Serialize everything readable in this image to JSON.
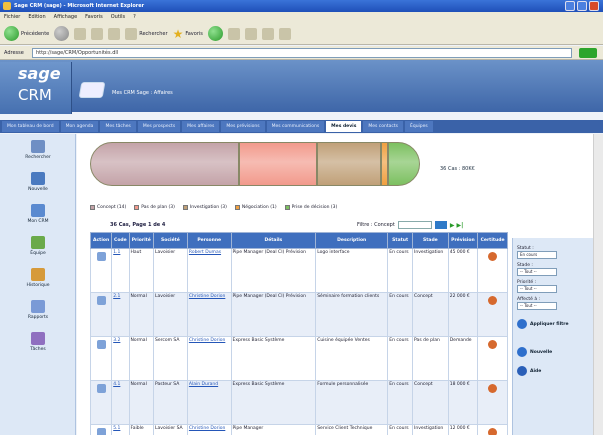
{
  "window": {
    "title": "Sage CRM (sage) - Microsoft Internet Explorer"
  },
  "menu": [
    "Fichier",
    "Edition",
    "Affichage",
    "Favoris",
    "Outils",
    "?"
  ],
  "toolbar": {
    "back": "Précédente",
    "search": "Rechercher",
    "favorites": "Favoris"
  },
  "address": {
    "label": "Adresse",
    "value": "http://sage/CRM/Opportunités.dll"
  },
  "header": {
    "brand_top": "sage",
    "brand_bottom": "CRM",
    "subtitle": "Mes CRM Sage : Affaires"
  },
  "tabs": [
    "Mon tableau de bord",
    "Mon agenda",
    "Mes tâches",
    "Mes prospects",
    "Mes affaires",
    "Mes prévisions",
    "Mes communications",
    "Mes devis",
    "Mes contacts",
    "Équipes"
  ],
  "active_tab_index": 7,
  "sidebar": [
    {
      "label": "Rechercher",
      "color": "#6f8fc4"
    },
    {
      "label": "Nouvelle",
      "color": "#4a7ac0"
    },
    {
      "label": "Mon CRM",
      "color": "#5a8ad0"
    },
    {
      "label": "Équipe",
      "color": "#6aaa4a"
    },
    {
      "label": "Historique",
      "color": "#d69a3a"
    },
    {
      "label": "Rapports",
      "color": "#7a9ad6"
    },
    {
      "label": "Tâches",
      "color": "#8f6fc0"
    }
  ],
  "pipeline": {
    "stages": [
      {
        "name": "Concept",
        "value": 42,
        "color": "#c4a3a8"
      },
      {
        "name": "Pas de plan",
        "value": 22,
        "color": "#f29a8c"
      },
      {
        "name": "Investigation",
        "value": 18,
        "color": "#c0a078"
      },
      {
        "name": "Négociation",
        "value": 2,
        "color": "#f0a040"
      },
      {
        "name": "Prise de décision",
        "value": 9,
        "color": "#7cc060"
      }
    ],
    "summary": "36 Cas : 80K€"
  },
  "legend": [
    "Concept (14)",
    "Pas de plan (3)",
    "Investigation (3)",
    "Négociation (1)",
    "Prise de décision (3)"
  ],
  "grid": {
    "pager": "36 Cas, Page 1 de 4",
    "filter_label": "Filtre : Concept",
    "headers": [
      "Action",
      "Code",
      "Priorité",
      "Société",
      "Personne",
      "Détails",
      "Description",
      "Statut",
      "Stade",
      "Prévision",
      "Certitude"
    ],
    "rows": [
      [
        "",
        "1.1",
        "Haut",
        "Lavoisier",
        "Robert Dumas",
        "Pipe Manager (Deal CI) Prévision",
        "Logo interface",
        "En cours",
        "Investigation",
        "45 000 €",
        ""
      ],
      [
        "",
        "2.1",
        "Normal",
        "Lavoisier",
        "Christine Dorion",
        "Pipe Manager (Deal CI) Prévision",
        "Séminaire formation clients",
        "En cours",
        "Concept",
        "22 000 €",
        ""
      ],
      [
        "",
        "3.2",
        "Normal",
        "Sercom SA",
        "Christine Dorion",
        "Express Basic Système",
        "Cuisine équipée Ventes",
        "En cours",
        "Pas de plan",
        "Demande",
        ""
      ],
      [
        "",
        "4.1",
        "Normal",
        "Pasteur SA",
        "Alain Durand",
        "Express Basic Système",
        "Formule personnalisée",
        "En cours",
        "Concept",
        "18 000 €",
        ""
      ],
      [
        "",
        "5.1",
        "Faible",
        "Lavoisier SA",
        "Christine Dorion",
        "Pipe Manager",
        "Service Client Technique",
        "En cours",
        "Investigation",
        "12 000 €",
        ""
      ]
    ]
  },
  "right_panel": {
    "filters": [
      {
        "label": "Statut :",
        "value": "En cours"
      },
      {
        "label": "Stade :",
        "value": "-- Tout --"
      },
      {
        "label": "Priorité :",
        "value": "-- Tout --"
      },
      {
        "label": "Affecté à :",
        "value": "-- Tout --"
      }
    ],
    "apply": "Appliquer filtre",
    "new_button": "Nouvelle",
    "help_button": "Aide"
  }
}
